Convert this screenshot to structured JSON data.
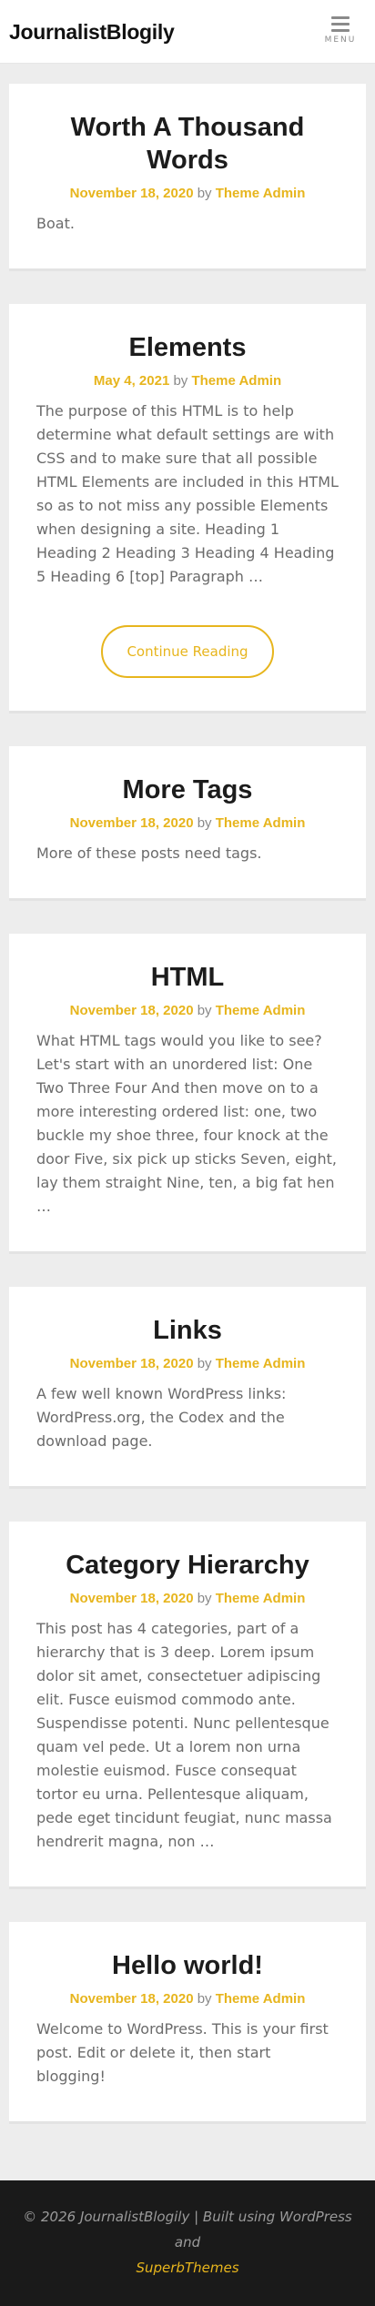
{
  "header": {
    "site_title": "JournalistBlogily",
    "menu_label": "MENU"
  },
  "posts": [
    {
      "title": "Worth A Thousand Words",
      "date": "November 18, 2020",
      "by": "by",
      "author": "Theme Admin",
      "excerpt": "Boat."
    },
    {
      "title": "Elements",
      "date": "May 4, 2021",
      "by": "by",
      "author": "Theme Admin",
      "excerpt": "The purpose of this HTML is to help determine what default settings are with CSS and to make sure that all possible HTML Elements are included in this HTML so as to not miss any possible Elements when designing a site. Heading 1 Heading 2 Heading 3 Heading 4 Heading 5 Heading 6 [top] Paragraph …",
      "button": "Continue Reading"
    },
    {
      "title": "More Tags",
      "date": "November 18, 2020",
      "by": "by",
      "author": "Theme Admin",
      "excerpt": "More of these posts need tags."
    },
    {
      "title": "HTML",
      "date": "November 18, 2020",
      "by": "by",
      "author": "Theme Admin",
      "excerpt": "What HTML tags would you like to see? Let's start with an unordered list: One Two Three Four And then move on to a more interesting ordered list: one, two buckle my shoe three, four knock at the door Five, six pick up sticks Seven, eight, lay them straight Nine, ten, a big fat hen …"
    },
    {
      "title": "Links",
      "date": "November 18, 2020",
      "by": "by",
      "author": "Theme Admin",
      "excerpt": "A few well known WordPress links: WordPress.org, the Codex and the download page."
    },
    {
      "title": "Category Hierarchy",
      "date": "November 18, 2020",
      "by": "by",
      "author": "Theme Admin",
      "excerpt": "This post has 4 categories, part of a hierarchy that is 3 deep. Lorem ipsum dolor sit amet, consectetuer adipiscing elit. Fusce euismod commodo ante. Suspendisse potenti. Nunc pellentesque quam vel pede. Ut a lorem non urna molestie euismod. Fusce consequat tortor eu urna. Pellentesque aliquam, pede eget tincidunt feugiat, nunc massa hendrerit magna, non …"
    },
    {
      "title": "Hello world!",
      "date": "November 18, 2020",
      "by": "by",
      "author": "Theme Admin",
      "excerpt": "Welcome to WordPress. This is your first post. Edit or delete it, then start blogging!"
    }
  ],
  "footer": {
    "copyright": "© 2026 JournalistBlogily | Built using WordPress and",
    "link": "SuperbThemes"
  },
  "colors": {
    "accent": "#e7b51d",
    "background": "#ededed",
    "footer_bg": "#1a1a1a"
  }
}
